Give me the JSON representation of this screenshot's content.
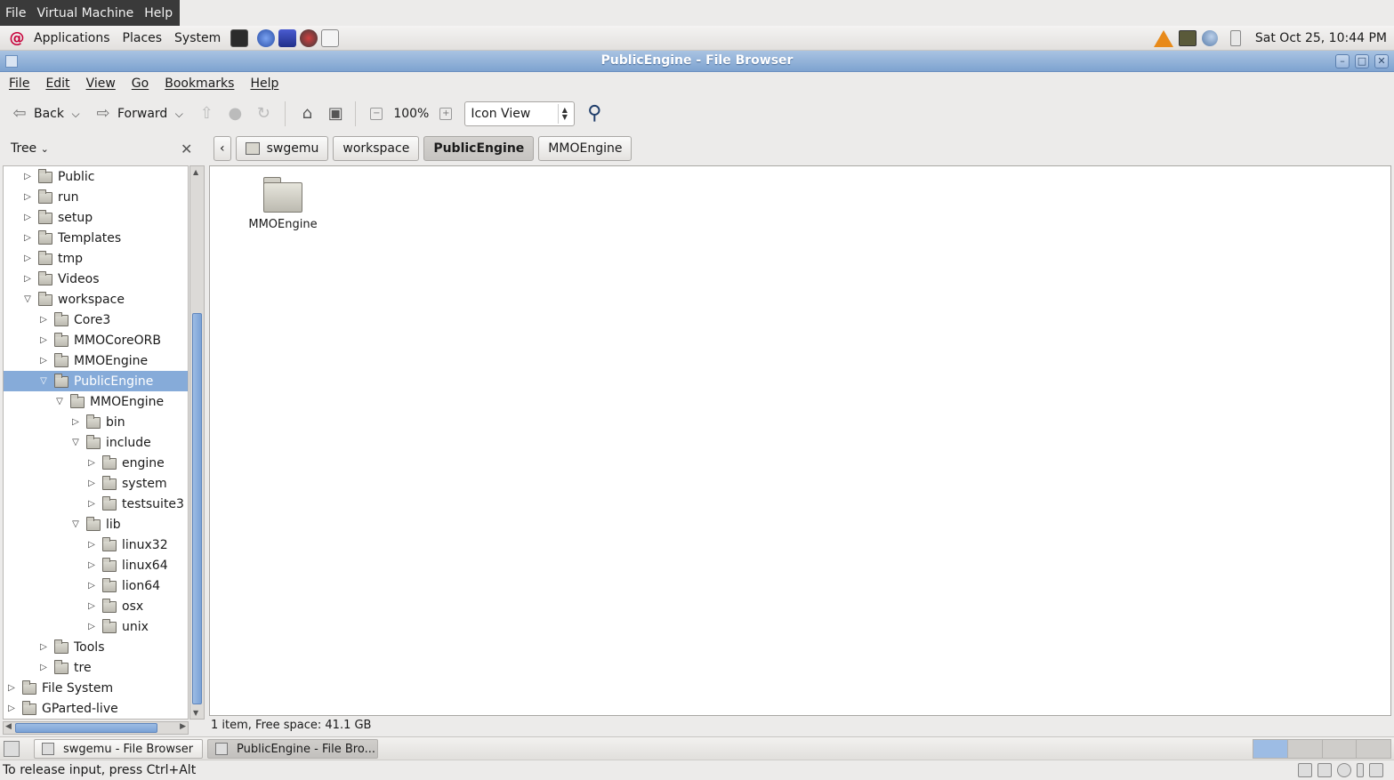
{
  "vm_menu": [
    "File",
    "Virtual Machine",
    "Help"
  ],
  "panel": {
    "menus": [
      "Applications",
      "Places",
      "System"
    ],
    "clock": "Sat Oct 25, 10:44 PM"
  },
  "window": {
    "title": "PublicEngine - File Browser"
  },
  "app_menu": [
    "File",
    "Edit",
    "View",
    "Go",
    "Bookmarks",
    "Help"
  ],
  "toolbar": {
    "back_label": "Back",
    "forward_label": "Forward",
    "zoom": "100%",
    "view_mode": "Icon View"
  },
  "side_pane": {
    "mode": "Tree",
    "items": [
      {
        "label": "Public",
        "depth": 1,
        "state": "collapsed"
      },
      {
        "label": "run",
        "depth": 1,
        "state": "collapsed"
      },
      {
        "label": "setup",
        "depth": 1,
        "state": "collapsed"
      },
      {
        "label": "Templates",
        "depth": 1,
        "state": "collapsed"
      },
      {
        "label": "tmp",
        "depth": 1,
        "state": "collapsed"
      },
      {
        "label": "Videos",
        "depth": 1,
        "state": "collapsed"
      },
      {
        "label": "workspace",
        "depth": 1,
        "state": "expanded"
      },
      {
        "label": "Core3",
        "depth": 2,
        "state": "collapsed"
      },
      {
        "label": "MMOCoreORB",
        "depth": 2,
        "state": "collapsed"
      },
      {
        "label": "MMOEngine",
        "depth": 2,
        "state": "collapsed"
      },
      {
        "label": "PublicEngine",
        "depth": 2,
        "state": "expanded",
        "selected": true
      },
      {
        "label": "MMOEngine",
        "depth": 3,
        "state": "expanded"
      },
      {
        "label": "bin",
        "depth": 4,
        "state": "collapsed"
      },
      {
        "label": "include",
        "depth": 4,
        "state": "expanded"
      },
      {
        "label": "engine",
        "depth": 5,
        "state": "collapsed"
      },
      {
        "label": "system",
        "depth": 5,
        "state": "collapsed"
      },
      {
        "label": "testsuite3",
        "depth": 5,
        "state": "collapsed"
      },
      {
        "label": "lib",
        "depth": 4,
        "state": "expanded"
      },
      {
        "label": "linux32",
        "depth": 5,
        "state": "collapsed"
      },
      {
        "label": "linux64",
        "depth": 5,
        "state": "collapsed"
      },
      {
        "label": "lion64",
        "depth": 5,
        "state": "collapsed"
      },
      {
        "label": "osx",
        "depth": 5,
        "state": "collapsed"
      },
      {
        "label": "unix",
        "depth": 5,
        "state": "collapsed"
      },
      {
        "label": "Tools",
        "depth": 2,
        "state": "collapsed"
      },
      {
        "label": "tre",
        "depth": 2,
        "state": "collapsed"
      },
      {
        "label": "File System",
        "depth": 0,
        "state": "collapsed"
      },
      {
        "label": "GParted-live",
        "depth": 0,
        "state": "collapsed"
      }
    ]
  },
  "pathbar": [
    "swgemu",
    "workspace",
    "PublicEngine",
    "MMOEngine"
  ],
  "pathbar_active": "PublicEngine",
  "content": {
    "items": [
      {
        "label": "MMOEngine",
        "icon": "folder-icon"
      }
    ]
  },
  "status": "1 item, Free space: 41.1 GB",
  "taskbar": {
    "tasks": [
      "swgemu - File Browser",
      "PublicEngine - File Bro..."
    ]
  },
  "vm_status": "To release input, press Ctrl+Alt"
}
